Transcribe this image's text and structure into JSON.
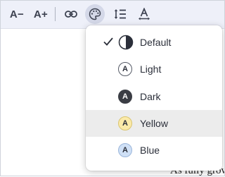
{
  "toolbar": {
    "font_decrease_label": "A−",
    "font_increase_label": "A+"
  },
  "theme_menu": {
    "selected": "Default",
    "items": [
      {
        "label": "Default",
        "swatch": "",
        "checked": true
      },
      {
        "label": "Light",
        "swatch": "A",
        "bg": "#ffffff",
        "fg": "#2b2f3a",
        "border": "#555a66"
      },
      {
        "label": "Dark",
        "swatch": "A",
        "bg": "#3a3d44",
        "fg": "#ffffff",
        "border": "#3a3d44"
      },
      {
        "label": "Yellow",
        "swatch": "A",
        "bg": "#fbeaa9",
        "fg": "#2b2f3a",
        "border": "#d9c46f",
        "hovered": true
      },
      {
        "label": "Blue",
        "swatch": "A",
        "bg": "#cfe0f6",
        "fg": "#2b2f3a",
        "border": "#9bb6da"
      }
    ]
  },
  "page_text": {
    "partial_line": "As fully grown",
    "partial_char": "."
  },
  "colors": {
    "toolbar_bg": "#eef0f9",
    "hover_bg": "#ececec"
  }
}
